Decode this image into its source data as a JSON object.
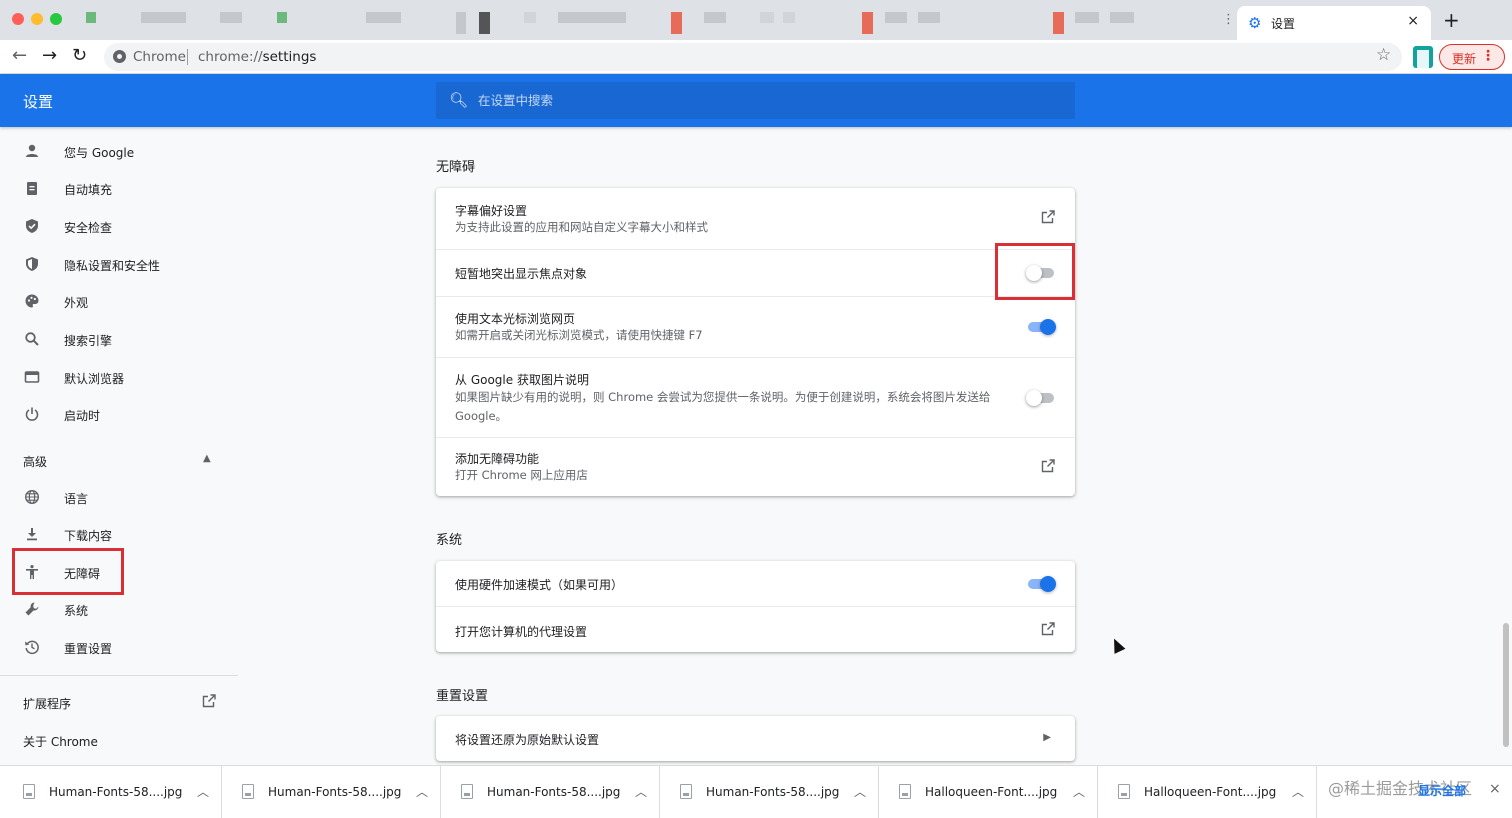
{
  "browser": {
    "active_tab": {
      "title": "设置",
      "close_icon": "×"
    },
    "new_tab_icon": "+",
    "tab_more": "⋮",
    "omnibox": {
      "site_label": "Chrome",
      "url_scheme": "chrome://",
      "url_path": "settings"
    },
    "update_button": {
      "label": "更新",
      "menu_icon": "⋮"
    }
  },
  "header": {
    "title": "设置",
    "search_placeholder": "在设置中搜索"
  },
  "sidebar": {
    "items": [
      {
        "label": "您与 Google",
        "icon": "person-icon"
      },
      {
        "label": "自动填充",
        "icon": "clipboard-icon"
      },
      {
        "label": "安全检查",
        "icon": "shield-check-icon"
      },
      {
        "label": "隐私设置和安全性",
        "icon": "shield-half-icon"
      },
      {
        "label": "外观",
        "icon": "palette-icon"
      },
      {
        "label": "搜索引擎",
        "icon": "search-icon"
      },
      {
        "label": "默认浏览器",
        "icon": "browser-icon"
      },
      {
        "label": "启动时",
        "icon": "power-icon"
      }
    ],
    "advanced": {
      "label": "高级"
    },
    "advanced_items": [
      {
        "label": "语言",
        "icon": "globe-icon"
      },
      {
        "label": "下载内容",
        "icon": "download-icon"
      },
      {
        "label": "无障碍",
        "icon": "accessibility-icon"
      },
      {
        "label": "系统",
        "icon": "wrench-icon"
      },
      {
        "label": "重置设置",
        "icon": "history-icon"
      }
    ],
    "extensions": {
      "label": "扩展程序"
    },
    "about": {
      "label": "关于 Chrome"
    }
  },
  "main": {
    "accessibility": {
      "title": "无障碍",
      "rows": [
        {
          "label": "字幕偏好设置",
          "sub": "为支持此设置的应用和网站自定义字幕大小和样式",
          "control": "external-link"
        },
        {
          "label": "短暂地突出显示焦点对象",
          "sub": "",
          "control": "toggle",
          "on": false
        },
        {
          "label": "使用文本光标浏览网页",
          "sub": "如需开启或关闭光标浏览模式，请使用快捷键 F7",
          "control": "toggle",
          "on": true
        },
        {
          "label": "从 Google 获取图片说明",
          "sub": "如果图片缺少有用的说明，则 Chrome 会尝试为您提供一条说明。为便于创建说明，系统会将图片发送给 Google。",
          "control": "toggle",
          "on": false
        },
        {
          "label": "添加无障碍功能",
          "sub": "打开 Chrome 网上应用店",
          "control": "external-link"
        }
      ]
    },
    "system": {
      "title": "系统",
      "rows": [
        {
          "label": "使用硬件加速模式（如果可用）",
          "control": "toggle",
          "on": true
        },
        {
          "label": "打开您计算机的代理设置",
          "control": "external-link"
        }
      ]
    },
    "reset": {
      "title": "重置设置",
      "rows": [
        {
          "label": "将设置还原为原始默认设置",
          "control": "chevron"
        }
      ]
    }
  },
  "downloads": {
    "items": [
      {
        "name": "Human-Fonts-58....jpg"
      },
      {
        "name": "Human-Fonts-58....jpg"
      },
      {
        "name": "Human-Fonts-58....jpg"
      },
      {
        "name": "Human-Fonts-58....jpg"
      },
      {
        "name": "Halloqueen-Font....jpg"
      },
      {
        "name": "Halloqueen-Font....jpg"
      }
    ],
    "show_all": "显示全部",
    "watermark": "@稀土掘金技术社区",
    "close_icon": "×"
  },
  "colors": {
    "accent": "#1a73e8",
    "highlight": "#d93036"
  }
}
